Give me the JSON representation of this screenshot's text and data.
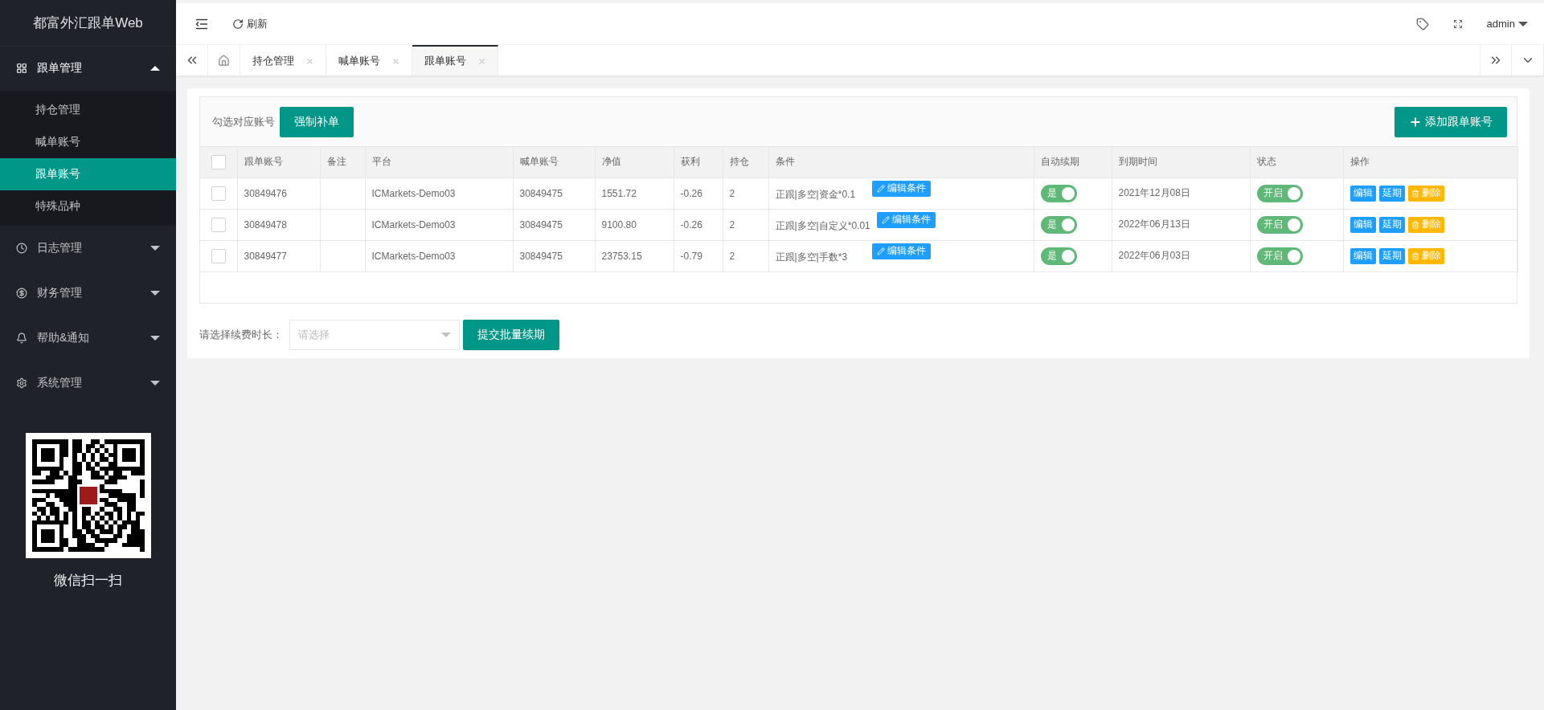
{
  "sidebar": {
    "title": "都富外汇跟单Web",
    "menus": [
      {
        "label": "跟单管理",
        "expanded": true,
        "children": [
          {
            "label": "持仓管理",
            "selected": false
          },
          {
            "label": "喊单账号",
            "selected": false
          },
          {
            "label": "跟单账号",
            "selected": true
          },
          {
            "label": "特殊品种",
            "selected": false
          }
        ]
      },
      {
        "label": "日志管理",
        "expanded": false
      },
      {
        "label": "财务管理",
        "expanded": false
      },
      {
        "label": "帮助&通知",
        "expanded": false
      },
      {
        "label": "系统管理",
        "expanded": false
      }
    ],
    "qr_caption": "微信扫一扫"
  },
  "topbar": {
    "refresh": "刷新",
    "user": "admin"
  },
  "tabs": [
    {
      "label": "持仓管理",
      "selected": false
    },
    {
      "label": "喊单账号",
      "selected": false
    },
    {
      "label": "跟单账号",
      "selected": true
    }
  ],
  "toolbar": {
    "label": "勾选对应账号",
    "force_button": "强制补单",
    "add_button": "添加跟单账号"
  },
  "table": {
    "select_all_checked": false,
    "columns": [
      "跟单账号",
      "备注",
      "平台",
      "喊单账号",
      "净值",
      "获利",
      "持仓",
      "条件",
      "自动续期",
      "到期时间",
      "状态",
      "操作"
    ],
    "rows": [
      {
        "checked": false,
        "account": "30849476",
        "platform": "ICMarkets-Demo03",
        "caller_account": "30849475",
        "equity": "1551.72",
        "profit": "-0.26",
        "positions": "2",
        "condition": "正跟|多空|资金*0.1",
        "edit_label": "编辑条件",
        "auto_renew": {
          "label": "是",
          "on": true
        },
        "expiry": "2021年12月08日",
        "status": {
          "label": "开启",
          "on": true
        },
        "actions": [
          {
            "kind": "edit",
            "label": "编辑"
          },
          {
            "kind": "extend",
            "label": "延期"
          },
          {
            "kind": "delete",
            "label": "删除"
          }
        ]
      },
      {
        "checked": false,
        "account": "30849478",
        "platform": "ICMarkets-Demo03",
        "caller_account": "30849475",
        "equity": "9100.80",
        "profit": "-0.26",
        "positions": "2",
        "condition": "正跟|多空|自定义*0.01",
        "edit_label": "编辑条件",
        "auto_renew": {
          "label": "是",
          "on": true
        },
        "expiry": "2022年06月13日",
        "status": {
          "label": "开启",
          "on": true
        },
        "actions": [
          {
            "kind": "edit",
            "label": "编辑"
          },
          {
            "kind": "extend",
            "label": "延期"
          },
          {
            "kind": "delete",
            "label": "删除"
          }
        ]
      },
      {
        "checked": false,
        "account": "30849477",
        "platform": "ICMarkets-Demo03",
        "caller_account": "30849475",
        "equity": "23753.15",
        "profit": "-0.79",
        "positions": "2",
        "condition": "正跟|多空|手数*3",
        "edit_label": "编辑条件",
        "auto_renew": {
          "label": "是",
          "on": true
        },
        "expiry": "2022年06月03日",
        "status": {
          "label": "开启",
          "on": true
        },
        "actions": [
          {
            "kind": "edit",
            "label": "编辑"
          },
          {
            "kind": "extend",
            "label": "延期"
          },
          {
            "kind": "delete",
            "label": "删除"
          }
        ]
      }
    ]
  },
  "renew_form": {
    "label": "请选择续费时长：",
    "placeholder": "请选择",
    "submit": "提交批量续期"
  }
}
